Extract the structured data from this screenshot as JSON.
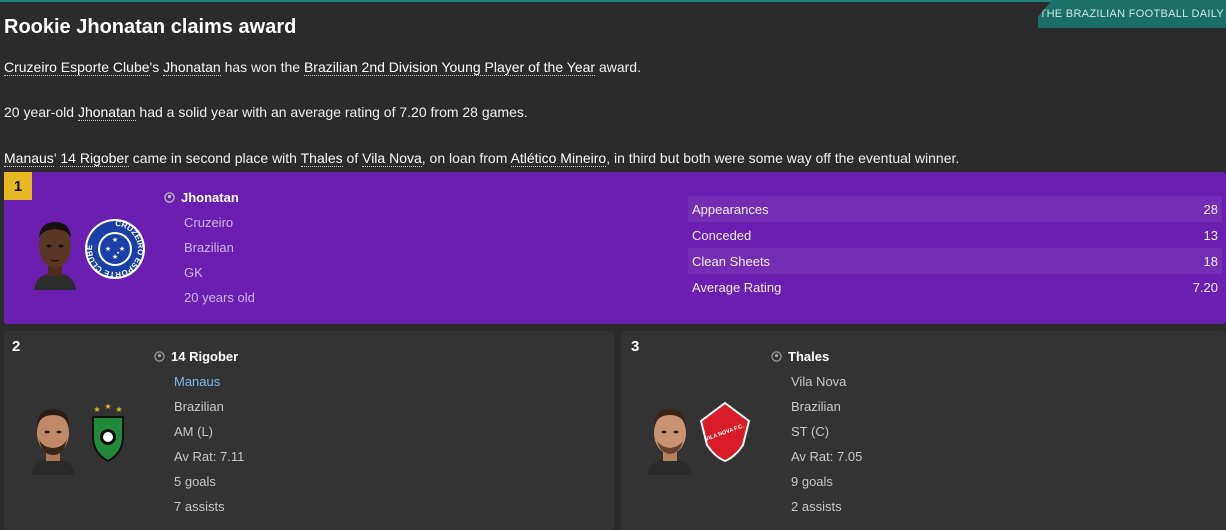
{
  "source": "THE BRAZILIAN FOOTBALL DAILY",
  "headline": "Rookie Jhonatan claims award",
  "p1": {
    "club": "Cruzeiro Esporte Clube",
    "possessive": "'s ",
    "player": "Jhonatan",
    "mid": " has won the ",
    "award": "Brazilian 2nd Division Young Player of the Year",
    "end": " award."
  },
  "p2": {
    "start": "20 year-old ",
    "player": "Jhonatan",
    "end": " had a solid year with an average rating of 7.20 from 28 games."
  },
  "p3": {
    "club1": "Manaus",
    "s1": "' ",
    "player2": "14 Rigober",
    "s2": " came in second place with ",
    "player3": "Thales",
    "s3": " of ",
    "club3": "Vila Nova",
    "s4": ", on loan from ",
    "loan_club": "Atlético Mineiro",
    "s5": ", in third but both were some way off the eventual winner."
  },
  "winner": {
    "rank": "1",
    "name": "Jhonatan",
    "club": "Cruzeiro",
    "nationality": "Brazilian",
    "position": "GK",
    "age": "20 years old",
    "stats": [
      {
        "label": "Appearances",
        "value": "28"
      },
      {
        "label": "Conceded",
        "value": "13"
      },
      {
        "label": "Clean Sheets",
        "value": "18"
      },
      {
        "label": "Average Rating",
        "value": "7.20"
      }
    ]
  },
  "second": {
    "rank": "2",
    "name": "14 Rigober",
    "club": "Manaus",
    "nationality": "Brazilian",
    "position": "AM (L)",
    "rating": "Av Rat: 7.11",
    "goals": "5 goals",
    "assists": "7 assists"
  },
  "third": {
    "rank": "3",
    "name": "Thales",
    "club": "Vila Nova",
    "nationality": "Brazilian",
    "position": "ST (C)",
    "rating": "Av Rat: 7.05",
    "goals": "9 goals",
    "assists": "2 assists"
  },
  "badges": {
    "cruzeiro_text": "CRUZEIRO ESPORTE CLUBE",
    "vila_nova_text": "VILA NOVA F.C."
  },
  "colors": {
    "accent": "#17877e",
    "winner_bg": "#6a1fb0",
    "rank_badge": "#e8b822",
    "link_blue": "#7db9f0"
  }
}
